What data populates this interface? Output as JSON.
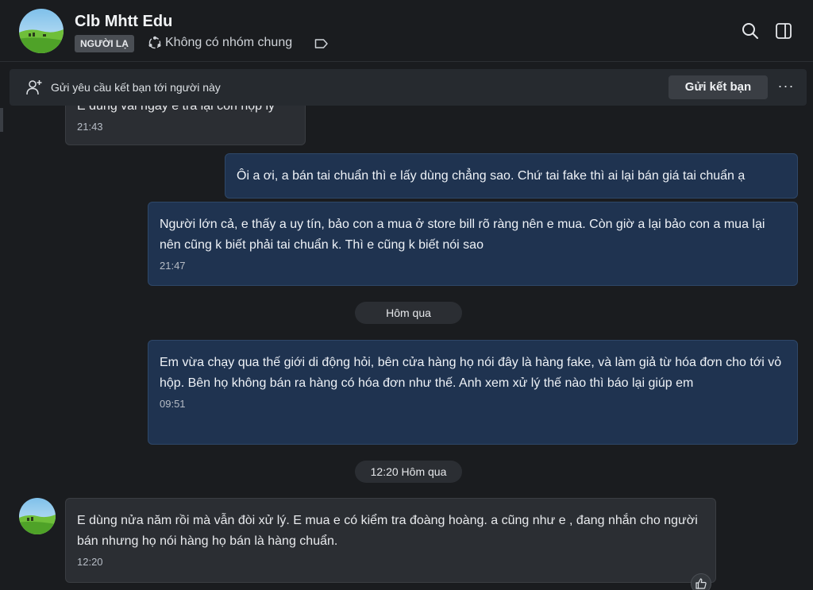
{
  "header": {
    "name": "Clb Mhtt Edu",
    "badge": "NGƯỜI LẠ",
    "group_info": "Không có nhóm chung",
    "icons": {
      "group": "group-icon",
      "tag": "tag-icon",
      "search": "search-icon",
      "panel": "sidebar-toggle-icon"
    }
  },
  "friend_request": {
    "text": "Gửi yêu cầu kết bạn tới người này",
    "button": "Gửi kết bạn",
    "more": "···"
  },
  "messages": [
    {
      "direction": "in",
      "text": "E dùng vài ngày e trả lại con hộp lý",
      "time": "21:43"
    },
    {
      "direction": "out",
      "text": "Ôi a ơi, a bán tai chuẩn thì e lấy dùng chẳng sao. Chứ tai fake thì ai lại bán giá tai chuẩn ạ",
      "time": ""
    },
    {
      "direction": "out",
      "text": "Người lớn cả, e thấy a uy tín, bảo con a mua ở store bill rõ ràng nên e mua. Còn giờ a lại bảo con a mua lại nên cũng k biết phải tai chuẩn k. Thì e cũng k biết nói sao",
      "time": "21:47"
    },
    {
      "direction": "out",
      "text": "Em vừa chạy qua thế giới di động hỏi, bên cửa hàng họ nói đây là hàng fake, và làm giả từ hóa đơn cho tới vỏ hộp. Bên họ không bán ra hàng có hóa đơn như thế. Anh xem xử lý thế nào thì báo lại giúp em",
      "time": "09:51"
    },
    {
      "direction": "in",
      "text": "E dùng nửa năm rồi mà vẫn đòi xử lý. E mua e có kiểm tra đoàng hoàng.  a cũng như e , đang nhắn cho người bán nhưng họ nói hàng họ bán là hàng chuẩn.",
      "time": "12:20"
    }
  ],
  "date_dividers": [
    "Hôm qua",
    "12:20 Hôm qua"
  ],
  "colors": {
    "background": "#1a1c1f",
    "incoming": "#2b2e33",
    "outgoing": "#1f3350"
  }
}
